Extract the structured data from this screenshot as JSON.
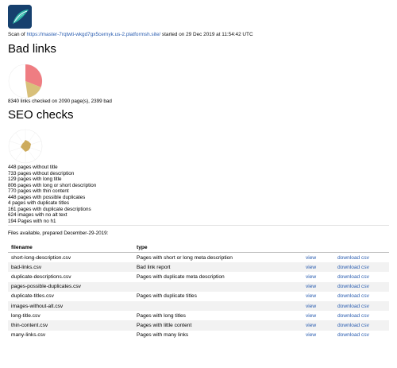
{
  "header": {
    "scan_prefix": "Scan of ",
    "scan_url": "https://master-7rqtwti-wkgd7gx5cernyk.us-2.platformsh.site/",
    "scan_suffix": " started on 29 Dec 2019 at 11:54:42 UTC"
  },
  "bad_links": {
    "heading": "Bad links",
    "summary": "8340 links checked on 2090 page(s), 2399 bad",
    "colors": {
      "bad": "#ef7d82",
      "other": "#d8c07a"
    }
  },
  "seo": {
    "heading": "SEO checks",
    "items": [
      "448 pages without title",
      "733 pages without description",
      "129 pages with long title",
      "806 pages with long or short description",
      "770 pages with thin content",
      "448 pages with possible duplicates",
      "4 pages with duplicate titles",
      "161 pages with duplicate descriptions",
      "624 images with no alt text",
      "194 Pages with no h1"
    ],
    "colors": {
      "accent": "#c8a24a"
    }
  },
  "files": {
    "note": "Files available, prepared December-29-2019:",
    "headers": {
      "filename": "filename",
      "type": "type"
    },
    "rows": [
      {
        "filename": "short-long-description.csv",
        "type": "Pages with short or long meta description",
        "view": "view",
        "download": "download csv"
      },
      {
        "filename": "bad-links.csv",
        "type": "Bad link report",
        "view": "view",
        "download": "download csv"
      },
      {
        "filename": "duplicate-descriptions.csv",
        "type": "Pages with duplicate meta description",
        "view": "view",
        "download": "download csv"
      },
      {
        "filename": "pages-possible-duplicates.csv",
        "type": "",
        "view": "view",
        "download": "download csv"
      },
      {
        "filename": "duplicate-titles.csv",
        "type": "Pages with duplicate titles",
        "view": "view",
        "download": "download csv"
      },
      {
        "filename": "images-without-alt.csv",
        "type": "",
        "view": "view",
        "download": "download csv"
      },
      {
        "filename": "long-title.csv",
        "type": "Pages with long titles",
        "view": "view",
        "download": "download csv"
      },
      {
        "filename": "thin-content.csv",
        "type": "Pages with little content",
        "view": "view",
        "download": "download csv"
      },
      {
        "filename": "many-links.csv",
        "type": "Pages with many links",
        "view": "view",
        "download": "download csv"
      }
    ]
  }
}
